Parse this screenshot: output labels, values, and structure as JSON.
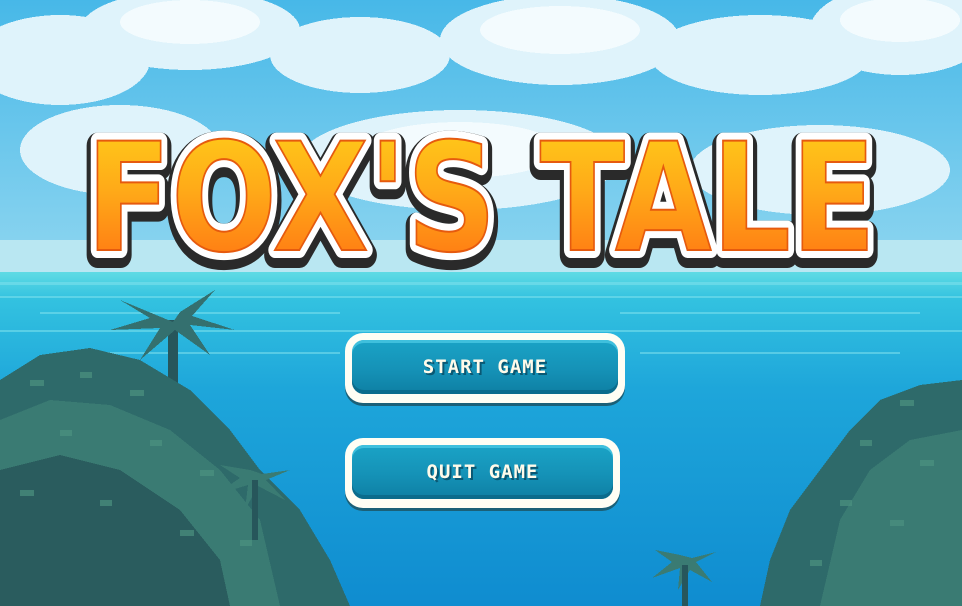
{
  "game": {
    "title": "FOX'S TALE"
  },
  "menu": {
    "start_label": "START GAME",
    "quit_label": "QUIT GAME"
  },
  "colors": {
    "sky_top": "#3fb9e6",
    "sea": "#20a8d8",
    "foliage": "#2f6b6e",
    "title_orange": "#ff8c1a",
    "title_yellow": "#ffd11a",
    "button_blue": "#1592b7",
    "button_border": "#fffef4"
  },
  "icons": [
    "cloud",
    "palm-tree",
    "bush",
    "ocean-wave"
  ]
}
